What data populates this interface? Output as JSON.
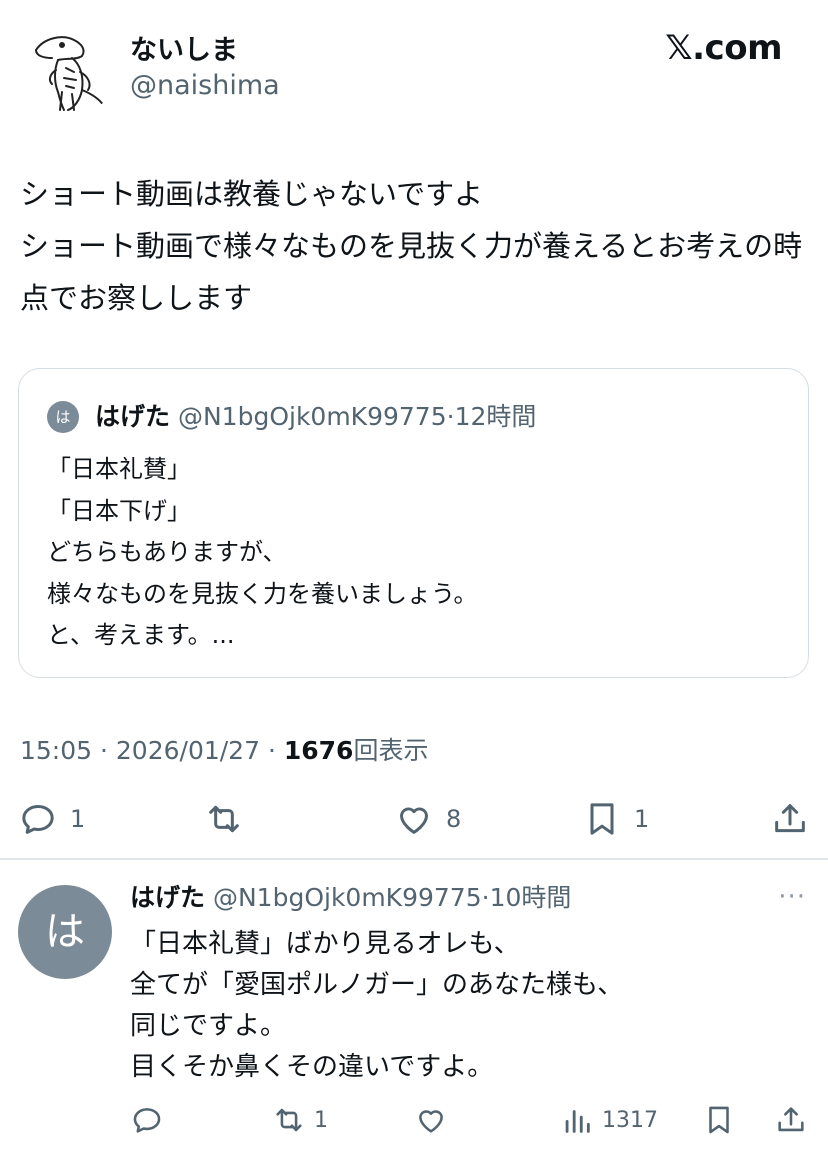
{
  "author": {
    "display_name": "ないしま",
    "handle": "@naishima",
    "avatar_icon": "dinosaur-sketch-avatar"
  },
  "brand": "𝕏.com",
  "post": {
    "text": "ショート動画は教養じゃないですよ\nショート動画で様々なものを見抜く力が養えるとお考えの時点でお察しします"
  },
  "quote": {
    "avatar_initial": "は",
    "name": "はげた",
    "handle": "@N1bgOjk0mK99775",
    "separator": "·",
    "time": "12時間",
    "text": "「日本礼賛」\n「日本下げ」\nどちらもありますが、\n様々なものを見抜く力を養いましょう。\nと、考えます。..."
  },
  "meta": {
    "time": "15:05",
    "separator": "·",
    "date": "2026/01/27",
    "views": "1676",
    "views_label": "回表示"
  },
  "actions": {
    "replies": "1",
    "likes": "8",
    "bookmarks": "1"
  },
  "reply": {
    "avatar_initial": "は",
    "name": "はげた",
    "handle": "@N1bgOjk0mK99775",
    "separator": "·",
    "time": "10時間",
    "more": "···",
    "text": "「日本礼賛」ばかり見るオレも、\n全てが「愛国ポルノガー」のあなた様も、\n同じですよ。\n目くそか鼻くその違いですよ。",
    "retweets": "1",
    "views": "1317"
  },
  "colors": {
    "text": "#0f1419",
    "secondary": "#536471",
    "border": "#d6dde2",
    "avatar_bg": "#7c8b98"
  }
}
